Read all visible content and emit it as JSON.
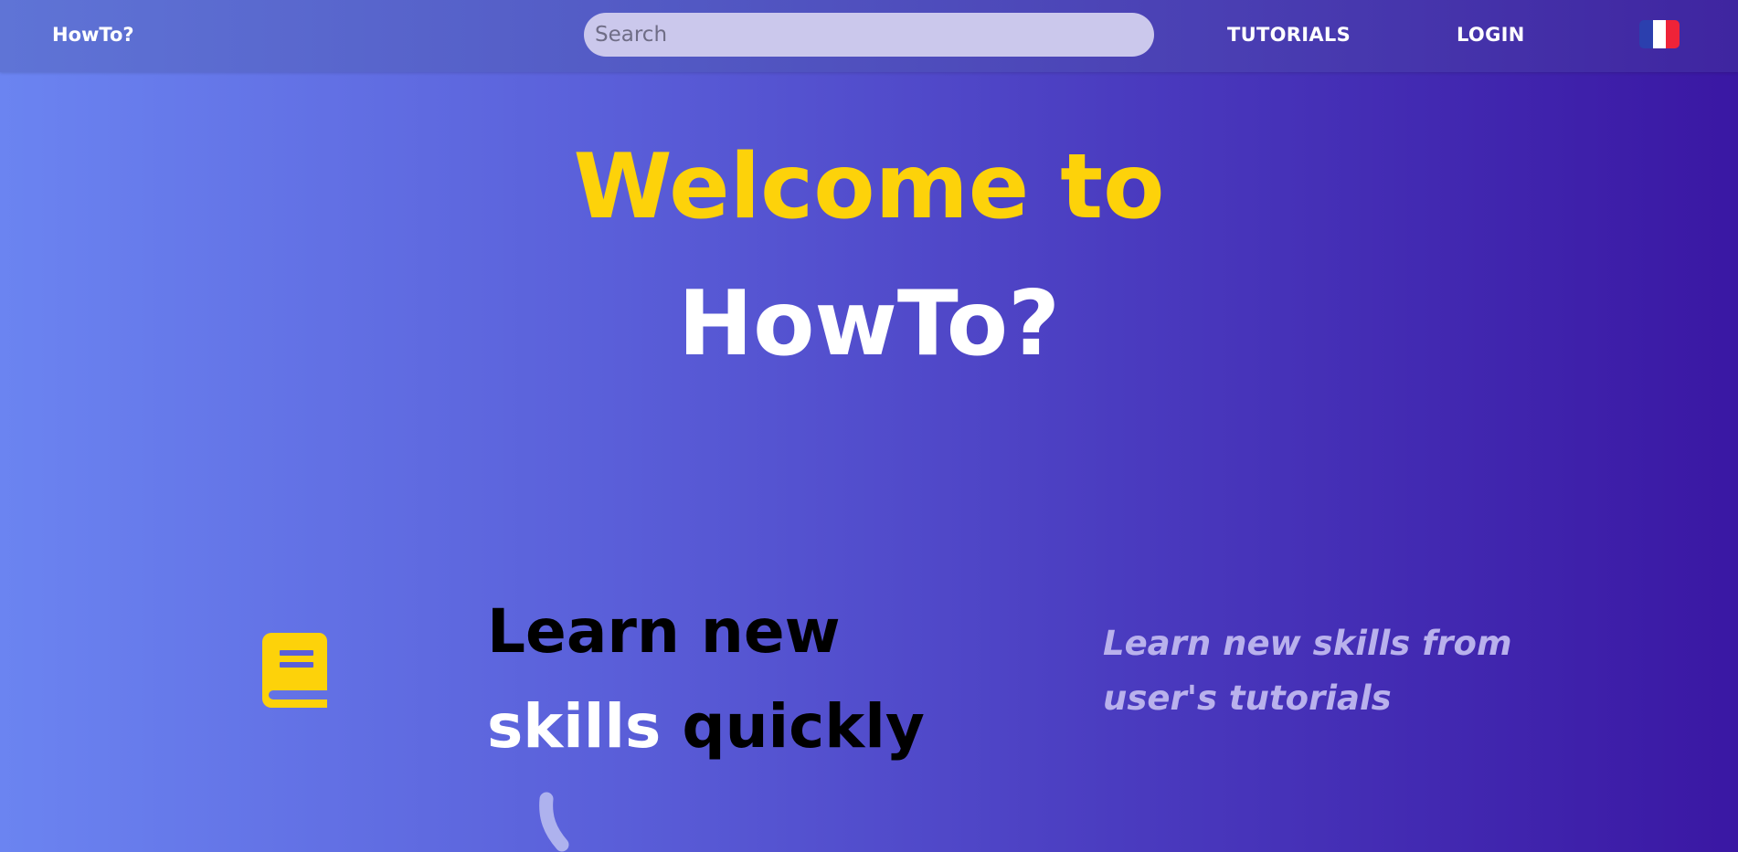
{
  "navbar": {
    "brand": "HowTo?",
    "search_placeholder": "Search",
    "tutorials_label": "TUTORIALS",
    "login_label": "LOGIN",
    "language_flag_icon": "france-flag-icon"
  },
  "hero": {
    "line1": "Welcome to",
    "line2": "HowTo?"
  },
  "feature": {
    "icon": "book-icon",
    "title_line1": "Learn new",
    "title_word_white": "skills",
    "title_rest": " quickly",
    "subtitle_line1": "Learn new skills from",
    "subtitle_line2": "user's tutorials"
  },
  "colors": {
    "accent_yellow": "#fdd20a",
    "gradient_start": "#6b84f1",
    "gradient_end": "#3a17a3",
    "search_bg": "#cbc8ec",
    "subtitle_lavender": "#b9b1ec"
  }
}
